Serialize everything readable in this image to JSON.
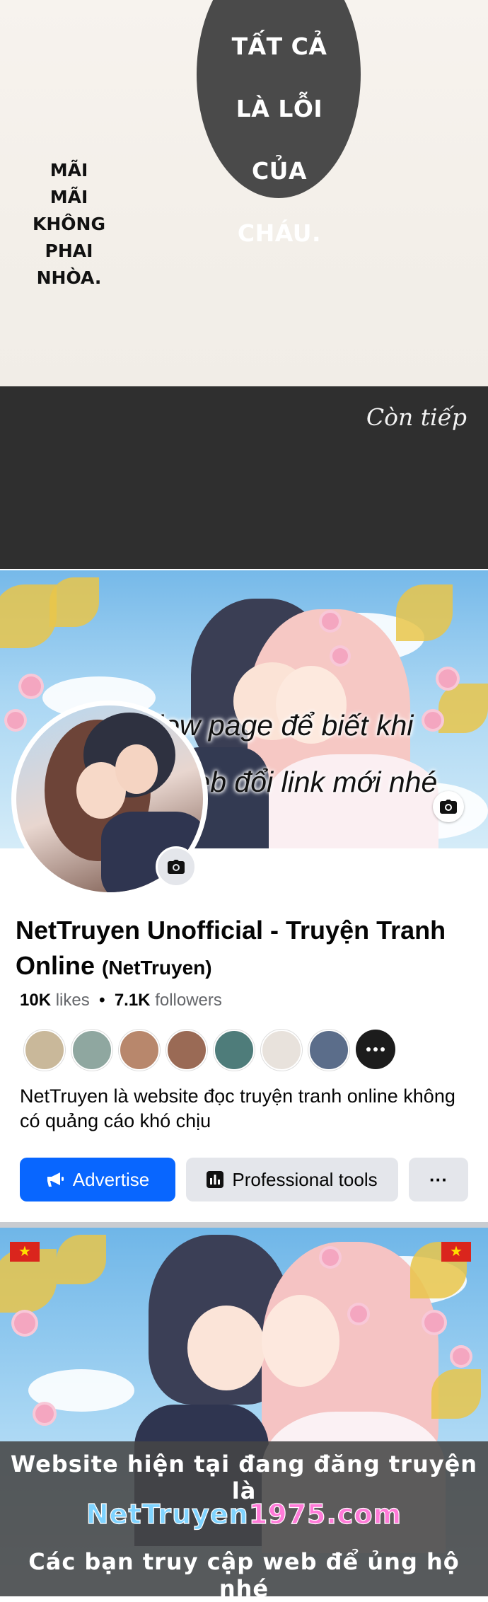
{
  "comic": {
    "bubble_lines": [
      "TẤT CẢ",
      "LÀ LỖI",
      "CỦA",
      "CHÁU."
    ],
    "caption_lines": [
      "MÃI MÃI",
      "KHÔNG",
      "PHAI",
      "NHÒA."
    ],
    "con_tiep": "Còn tiếp"
  },
  "banner": {
    "overlay_lines": [
      "Follow page để biết khi",
      "nào web đổi link mới nhé"
    ],
    "camera_icon": "camera-icon"
  },
  "page": {
    "name": "NetTruyen Unofficial - Truyện Tranh Online",
    "handle": "(NetTruyen)",
    "likes_count": "10K",
    "likes_label": "likes",
    "separator": "•",
    "followers_count": "7.1K",
    "followers_label": "followers",
    "about": "NetTruyen là website đọc truyện tranh online không có quảng cáo khó chịu",
    "friend_avatar_colors": [
      "#c9b89a",
      "#8fa7a0",
      "#b8876c",
      "#9a6a55",
      "#4e7c7a",
      "#e8e2dc",
      "#5b6d8a"
    ],
    "more_friends_icon": "more-horizontal-icon"
  },
  "actions": {
    "advertise_label": "Advertise",
    "advertise_icon": "megaphone-icon",
    "tools_label": "Professional tools",
    "tools_icon": "bar-chart-icon",
    "more_label": "···"
  },
  "notice": {
    "line1": "Website hiện tại đang đăng truyện là",
    "url_main": "NetTruyen",
    "url_number": "1975",
    "url_tld": ".com",
    "line3": "Các bạn truy cập web để ủng hộ nhé"
  },
  "colors": {
    "fb_blue": "#0866ff",
    "button_gray": "#e4e6eb",
    "dark_band": "#2f2f2f",
    "bubble": "#4a4a4a"
  }
}
